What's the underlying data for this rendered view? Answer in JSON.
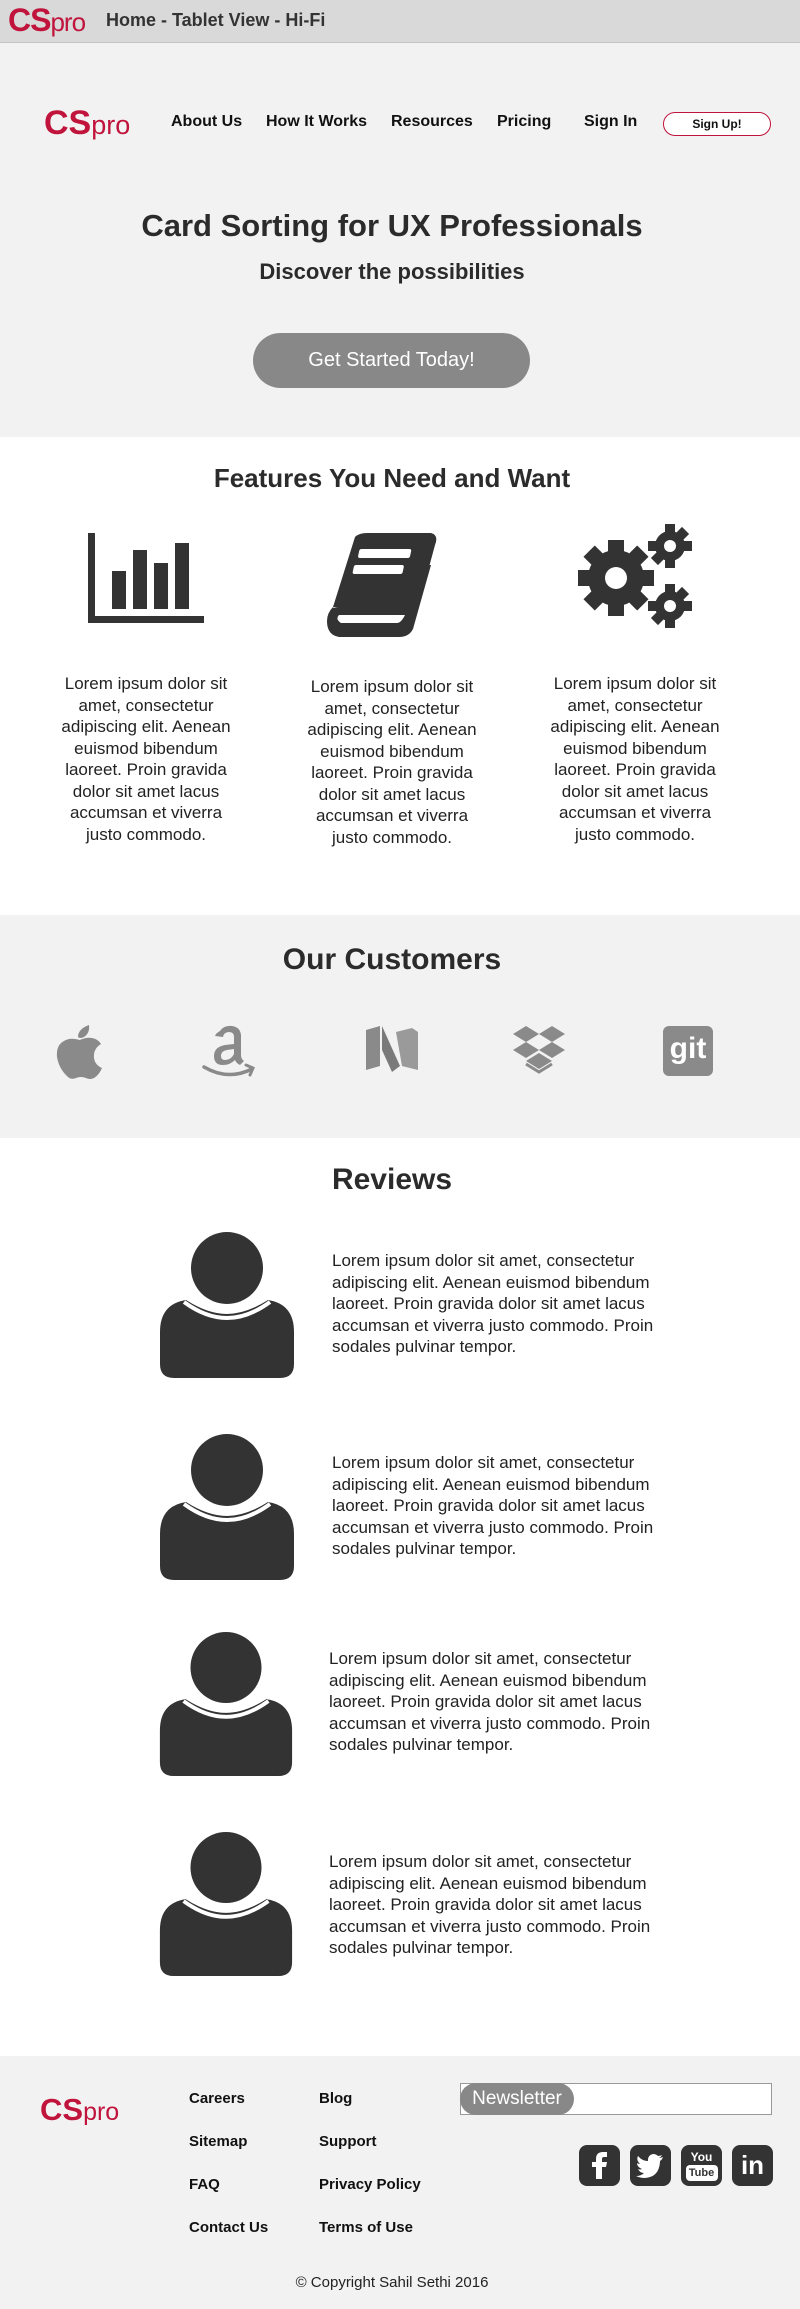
{
  "window": {
    "logo_cs": "CS",
    "logo_pro": "pro",
    "title": "Home - Tablet View - Hi-Fi"
  },
  "header": {
    "logo_cs": "CS",
    "logo_pro": "pro",
    "nav": [
      "About Us",
      "How It Works",
      "Resources",
      "Pricing",
      "Sign In"
    ],
    "signup": "Sign Up!"
  },
  "hero": {
    "title": "Card Sorting for UX Professionals",
    "subtitle": "Discover the possibilities",
    "cta": "Get Started Today!"
  },
  "features": {
    "title": "Features You Need and Want",
    "items": [
      {
        "icon": "bar-chart-icon",
        "text": "Lorem ipsum dolor sit amet, consectetur adipiscing elit. Aenean euismod bibendum laoreet. Proin gravida dolor sit amet lacus accumsan et viverra justo commodo."
      },
      {
        "icon": "book-icon",
        "text": "Lorem ipsum dolor sit amet, consectetur adipiscing elit. Aenean euismod bibendum laoreet. Proin gravida dolor sit amet lacus accumsan et viverra justo commodo."
      },
      {
        "icon": "gears-icon",
        "text": "Lorem ipsum dolor sit amet, consectetur adipiscing elit. Aenean euismod bibendum laoreet. Proin gravida dolor sit amet lacus accumsan et viverra justo commodo."
      }
    ]
  },
  "customers": {
    "title": "Our Customers",
    "logos": [
      "apple-icon",
      "amazon-icon",
      "medium-icon",
      "dropbox-icon",
      "git-icon"
    ],
    "git_text": "git"
  },
  "reviews": {
    "title": "Reviews",
    "items": [
      {
        "text": "Lorem ipsum dolor sit amet, consectetur adipiscing elit. Aenean euismod bibendum laoreet. Proin gravida dolor sit amet lacus accumsan et viverra justo commodo. Proin sodales pulvinar tempor."
      },
      {
        "text": "Lorem ipsum dolor sit amet, consectetur adipiscing elit. Aenean euismod bibendum laoreet. Proin gravida dolor sit amet lacus accumsan et viverra justo commodo. Proin sodales pulvinar tempor."
      },
      {
        "text": "Lorem ipsum dolor sit amet, consectetur adipiscing elit. Aenean euismod bibendum laoreet. Proin gravida dolor sit amet lacus accumsan et viverra justo commodo. Proin sodales pulvinar tempor."
      },
      {
        "text": "Lorem ipsum dolor sit amet, consectetur adipiscing elit. Aenean euismod bibendum laoreet. Proin gravida dolor sit amet lacus accumsan et viverra justo commodo. Proin sodales pulvinar tempor."
      }
    ]
  },
  "footer": {
    "logo_cs": "CS",
    "logo_pro": "pro",
    "links_col1": [
      "Careers",
      "Sitemap",
      "FAQ",
      "Contact Us"
    ],
    "links_col2": [
      "Blog",
      "Support",
      "Privacy Policy",
      "Terms of Use"
    ],
    "newsletter_label": "Newsletter",
    "newsletter_value": "",
    "social": [
      "facebook-icon",
      "twitter-icon",
      "youtube-icon",
      "linkedin-icon"
    ],
    "youtube_text_1": "You",
    "youtube_text_2": "Tube",
    "linkedin_text": "in",
    "copyright": "© Copyright Sahil Sethi 2016"
  },
  "colors": {
    "brand": "#c0143c",
    "dark": "#333333",
    "button_gray": "#888888"
  }
}
